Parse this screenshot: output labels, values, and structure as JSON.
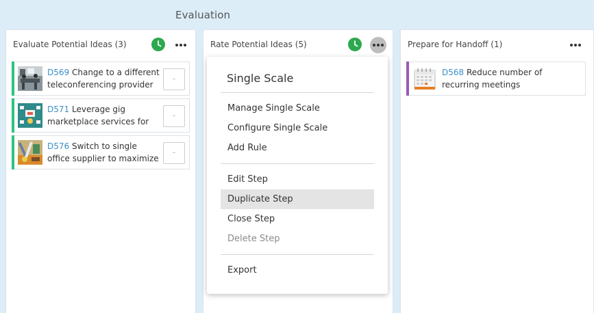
{
  "stage": {
    "title": "Evaluation"
  },
  "columns": [
    {
      "title": "Evaluate Potential Ideas",
      "count": "(3)",
      "cards": [
        {
          "id": "D569",
          "text": "Change to a different teleconferencing provider",
          "rating": "–",
          "accent": "#2ec27e",
          "thumb": "office-meeting-photo"
        },
        {
          "id": "D571",
          "text": "Leverage gig marketplace services for",
          "rating": "–",
          "accent": "#2ec27e",
          "thumb": "gig-marketplace-illustration"
        },
        {
          "id": "D576",
          "text": "Switch to single office supplier to maximize",
          "rating": "–",
          "accent": "#2ec27e",
          "thumb": "office-supplies-photo"
        }
      ]
    },
    {
      "title": "Rate Potential Ideas",
      "count": "(5)"
    },
    {
      "title": "Prepare for Handoff",
      "count": "(1)",
      "cards": [
        {
          "id": "D568",
          "text": "Reduce number of recurring meetings",
          "accent": "#9b59b6",
          "thumb": "calendar-icon"
        }
      ]
    }
  ],
  "menu": {
    "title": "Single Scale",
    "groups": [
      [
        "Manage Single Scale",
        "Configure Single Scale",
        "Add Rule"
      ],
      [
        "Edit Step",
        "Duplicate Step",
        "Close Step",
        "Delete Step"
      ],
      [
        "Export"
      ]
    ],
    "hovered": "Duplicate Step",
    "disabled": [
      "Delete Step"
    ]
  },
  "colors": {
    "background": "#dcedf8",
    "clock": "#2ea84f",
    "link": "#3a8fc7"
  }
}
